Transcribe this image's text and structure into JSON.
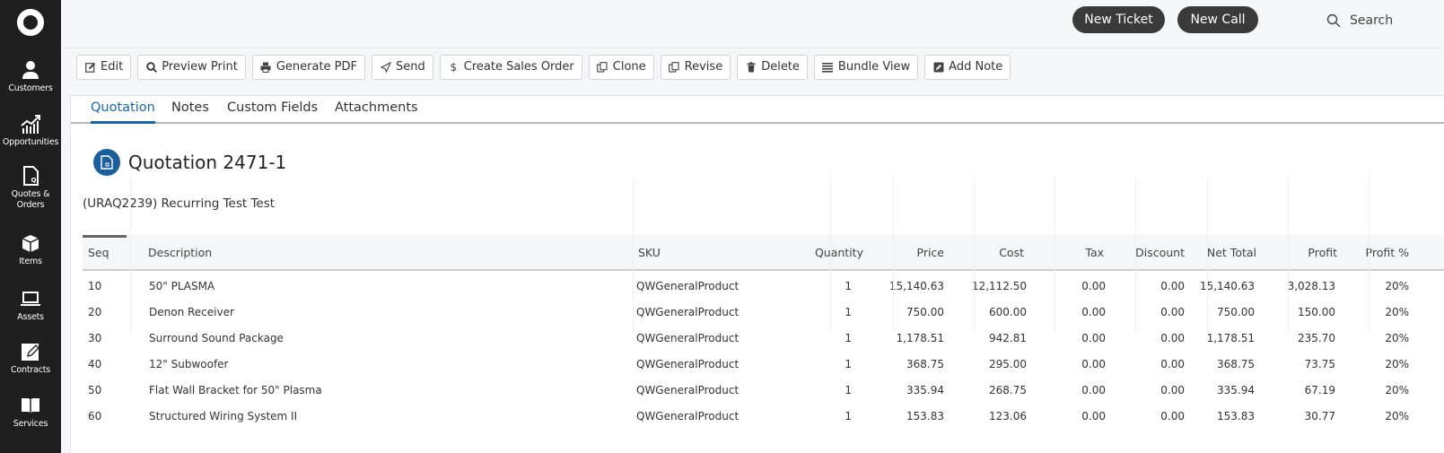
{
  "sidebar": {
    "logo": "app-logo",
    "items": [
      {
        "label": "Customers",
        "icon": "person-icon"
      },
      {
        "label": "Opportunities",
        "icon": "chart-growth-icon"
      },
      {
        "label": "Quotes & Orders",
        "icon": "quote-document-icon"
      },
      {
        "label": "Items",
        "icon": "box-icon"
      },
      {
        "label": "Assets",
        "icon": "laptop-icon"
      },
      {
        "label": "Contracts",
        "icon": "pencil-square-icon"
      },
      {
        "label": "Services",
        "icon": "book-icon"
      }
    ]
  },
  "header": {
    "new_ticket": "New Ticket",
    "new_call": "New Call",
    "search_label": "Search"
  },
  "toolbar": {
    "buttons": [
      {
        "label": "Edit",
        "icon": "edit-icon"
      },
      {
        "label": "Preview Print",
        "icon": "search-icon"
      },
      {
        "label": "Generate PDF",
        "icon": "print-icon"
      },
      {
        "label": "Send",
        "icon": "send-icon"
      },
      {
        "label": "Create Sales Order",
        "icon": "dollar-icon"
      },
      {
        "label": "Clone",
        "icon": "copy-icon"
      },
      {
        "label": "Revise",
        "icon": "copy-icon"
      },
      {
        "label": "Delete",
        "icon": "trash-icon"
      },
      {
        "label": "Bundle View",
        "icon": "list-icon"
      },
      {
        "label": "Add Note",
        "icon": "note-icon"
      }
    ]
  },
  "tabs": [
    {
      "label": "Quotation",
      "active": true
    },
    {
      "label": "Notes",
      "active": false
    },
    {
      "label": "Custom Fields",
      "active": false
    },
    {
      "label": "Attachments",
      "active": false
    }
  ],
  "quotation": {
    "title": "Quotation 2471-1",
    "subtitle": "(URAQ2239) Recurring Test Test"
  },
  "table": {
    "columns": [
      "Seq",
      "Description",
      "SKU",
      "Quantity",
      "Price",
      "Cost",
      "Tax",
      "Discount",
      "Net Total",
      "Profit",
      "Profit %"
    ],
    "rows": [
      [
        "10",
        "50\" PLASMA",
        "QWGeneralProduct",
        "1",
        "15,140.63",
        "12,112.50",
        "0.00",
        "0.00",
        "15,140.63",
        "3,028.13",
        "20%"
      ],
      [
        "20",
        "Denon Receiver",
        "QWGeneralProduct",
        "1",
        "750.00",
        "600.00",
        "0.00",
        "0.00",
        "750.00",
        "150.00",
        "20%"
      ],
      [
        "30",
        "Surround Sound Package",
        "QWGeneralProduct",
        "1",
        "1,178.51",
        "942.81",
        "0.00",
        "0.00",
        "1,178.51",
        "235.70",
        "20%"
      ],
      [
        "40",
        "12\" Subwoofer",
        "QWGeneralProduct",
        "1",
        "368.75",
        "295.00",
        "0.00",
        "0.00",
        "368.75",
        "73.75",
        "20%"
      ],
      [
        "50",
        "Flat Wall Bracket for 50\" Plasma",
        "QWGeneralProduct",
        "1",
        "335.94",
        "268.75",
        "0.00",
        "0.00",
        "335.94",
        "67.19",
        "20%"
      ],
      [
        "60",
        "Structured Wiring System II",
        "QWGeneralProduct",
        "1",
        "153.83",
        "123.06",
        "0.00",
        "0.00",
        "153.83",
        "30.77",
        "20%"
      ]
    ]
  },
  "colors": {
    "sidebar_bg": "#1f1f1f",
    "accent": "#22639b",
    "pill_bg": "#3a3a3a"
  }
}
